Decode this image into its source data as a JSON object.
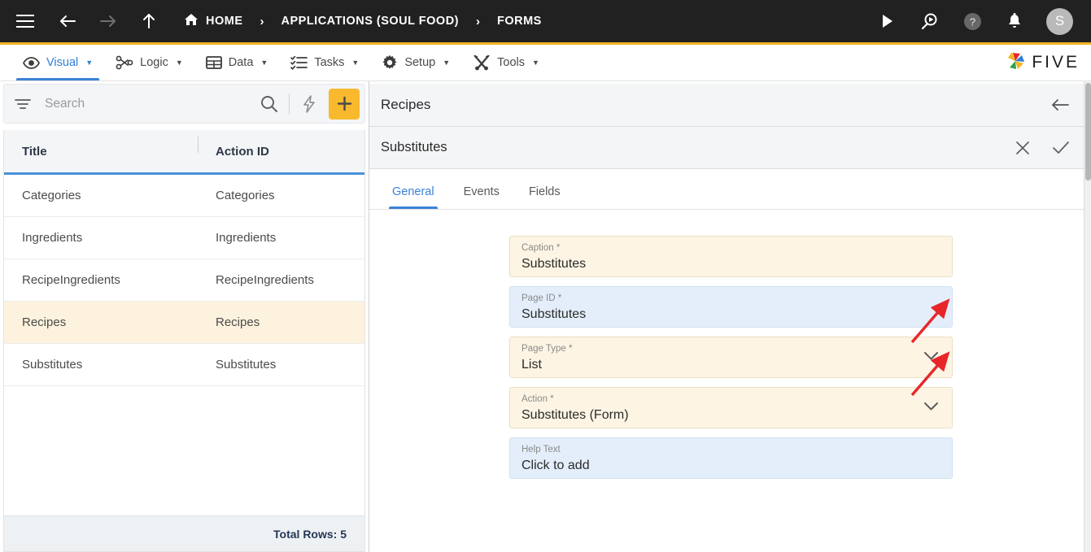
{
  "topbar": {
    "menu_icon": "hamburger-menu-icon",
    "back_icon": "arrow-left-icon",
    "forward_icon": "arrow-right-icon",
    "up_icon": "arrow-up-icon",
    "breadcrumbs": [
      {
        "label": "HOME",
        "icon": "home-icon"
      },
      {
        "label": "APPLICATIONS (SOUL FOOD)",
        "icon": ""
      },
      {
        "label": "FORMS",
        "icon": ""
      }
    ],
    "separator": "›",
    "right_icons": [
      "play-icon",
      "search-play-icon",
      "help-circle-icon",
      "bell-icon"
    ],
    "avatar_initial": "S"
  },
  "accent_color": "#f5b324",
  "menubar": {
    "items": [
      {
        "label": "Visual",
        "icon": "eye-icon",
        "caret": "▼",
        "active": true
      },
      {
        "label": "Logic",
        "icon": "logic-flow-icon",
        "caret": "▼",
        "active": false
      },
      {
        "label": "Data",
        "icon": "grid-table-icon",
        "caret": "▼",
        "active": false
      },
      {
        "label": "Tasks",
        "icon": "checklist-icon",
        "caret": "▼",
        "active": false
      },
      {
        "label": "Setup",
        "icon": "gear-icon",
        "caret": "▼",
        "active": false
      },
      {
        "label": "Tools",
        "icon": "tools-icon",
        "caret": "▼",
        "active": false
      }
    ],
    "brand": "FIVE",
    "brand_icon": "five-pinwheel-logo",
    "active_color": "#3b82d6"
  },
  "left_panel": {
    "filter_icon": "filter-icon",
    "search": {
      "placeholder": "Search",
      "value": ""
    },
    "search_icon": "search-icon",
    "bolt_icon": "lightning-bolt-icon",
    "add_button": {
      "icon": "plus-icon",
      "color": "#f8b92e"
    },
    "table": {
      "columns": [
        "Title",
        "Action ID"
      ],
      "rows": [
        {
          "title": "Categories",
          "action_id": "Categories",
          "selected": false
        },
        {
          "title": "Ingredients",
          "action_id": "Ingredients",
          "selected": false
        },
        {
          "title": "RecipeIngredients",
          "action_id": "RecipeIngredients",
          "selected": false
        },
        {
          "title": "Recipes",
          "action_id": "Recipes",
          "selected": true
        },
        {
          "title": "Substitutes",
          "action_id": "Substitutes",
          "selected": false
        }
      ],
      "footer": "Total Rows: 5",
      "selected_row_color": "#fdf2dd",
      "header_underline_color": "#4a90d9"
    }
  },
  "right_panel": {
    "header": {
      "title": "Recipes",
      "back_icon": "arrow-left-icon"
    },
    "subheader": {
      "title": "Substitutes",
      "cancel_icon": "close-x-icon",
      "confirm_icon": "check-icon"
    },
    "tabs": [
      {
        "label": "General",
        "active": true
      },
      {
        "label": "Events",
        "active": false
      },
      {
        "label": "Fields",
        "active": false
      }
    ],
    "fields": [
      {
        "label": "Caption *",
        "value": "Substitutes",
        "style": "cream",
        "dropdown": false,
        "annotated": false
      },
      {
        "label": "Page ID *",
        "value": "Substitutes",
        "style": "blue",
        "dropdown": false,
        "annotated": false
      },
      {
        "label": "Page Type *",
        "value": "List",
        "style": "cream",
        "dropdown": true,
        "annotated": true
      },
      {
        "label": "Action *",
        "value": "Substitutes (Form)",
        "style": "cream",
        "dropdown": true,
        "annotated": true
      },
      {
        "label": "Help Text",
        "value": "Click to add",
        "style": "blue",
        "dropdown": false,
        "annotated": false
      }
    ],
    "annotation_color": "#e8262a",
    "field_colors": {
      "cream": "#fdf4e3",
      "blue": "#e3eefa"
    }
  }
}
